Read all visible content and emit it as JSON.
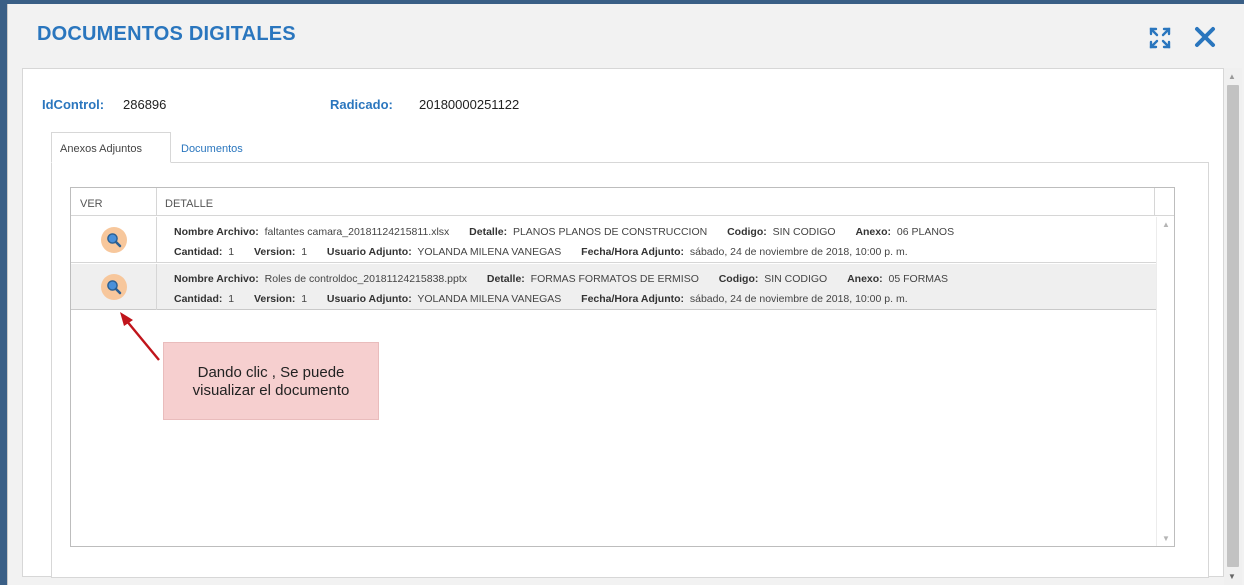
{
  "window": {
    "title": "DOCUMENTOS DIGITALES",
    "actions": [
      {
        "name": "expand-icon"
      },
      {
        "name": "close-icon"
      }
    ]
  },
  "info": {
    "idcontrol_label": "IdControl:",
    "idcontrol_value": "286896",
    "radicado_label": "Radicado:",
    "radicado_value": "20180000251122"
  },
  "tabs": [
    {
      "label": "Anexos Adjuntos",
      "active": true
    },
    {
      "label": "Documentos",
      "active": false
    }
  ],
  "grid": {
    "columns": [
      "VER",
      "DETALLE"
    ],
    "field_labels": {
      "nombre": "Nombre Archivo:",
      "detalle": "Detalle:",
      "codigo": "Codigo:",
      "anexo": "Anexo:",
      "cantidad": "Cantidad:",
      "version": "Version:",
      "usuario": "Usuario Adjunto:",
      "fecha": "Fecha/Hora Adjunto:"
    },
    "rows": [
      {
        "nombre": "faltantes camara_20181124215811.xlsx",
        "detalle": "PLANOS PLANOS DE CONSTRUCCION",
        "codigo": "SIN CODIGO",
        "anexo": "06 PLANOS",
        "cantidad": "1",
        "version": "1",
        "usuario": "YOLANDA MILENA VANEGAS",
        "fecha": "sábado, 24 de noviembre de 2018, 10:00 p. m."
      },
      {
        "nombre": "Roles de controldoc_20181124215838.pptx",
        "detalle": "FORMAS FORMATOS DE ERMISO",
        "codigo": "SIN CODIGO",
        "anexo": "05 FORMAS",
        "cantidad": "1",
        "version": "1",
        "usuario": "YOLANDA MILENA VANEGAS",
        "fecha": "sábado, 24 de noviembre de 2018, 10:00 p. m."
      }
    ]
  },
  "callout": {
    "line1": "Dando clic , Se puede",
    "line2": "visualizar el documento"
  },
  "colors": {
    "accent": "#2a76be",
    "frame": "#3a5f86",
    "view_button": "#f7c79c",
    "callout_bg": "#f6cfcf",
    "arrow": "#c0141b"
  }
}
